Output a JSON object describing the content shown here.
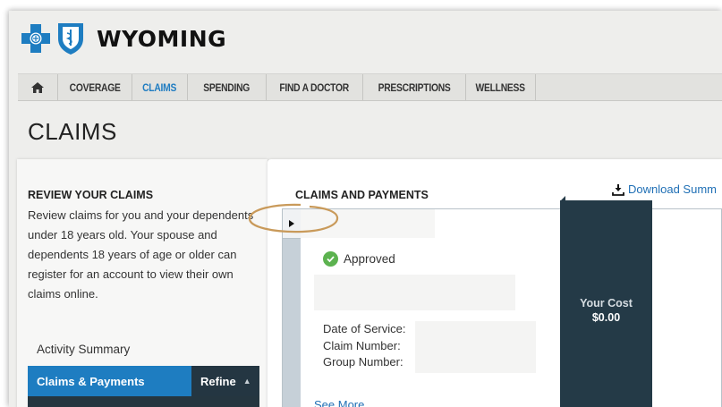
{
  "brand": {
    "name": "WYOMING",
    "cross_color": "#1e7dc1",
    "shield_color": "#1e7dc1"
  },
  "nav": {
    "home_icon": "home-icon",
    "items": [
      {
        "label": "COVERAGE",
        "active": false
      },
      {
        "label": "CLAIMS",
        "active": true
      },
      {
        "label": "SPENDING",
        "active": false
      },
      {
        "label": "FIND A DOCTOR",
        "active": false
      },
      {
        "label": "PRESCRIPTIONS",
        "active": false
      },
      {
        "label": "WELLNESS",
        "active": false
      }
    ]
  },
  "page": {
    "title": "CLAIMS"
  },
  "review": {
    "heading": "REVIEW YOUR CLAIMS",
    "text": "Review claims for you and your dependents under 18 years old. Your spouse and dependents 18 years of age or older can register for an account to view their own claims online.",
    "activity_summary": "Activity Summary",
    "bar_label": "Claims & Payments",
    "refine_label": "Refine"
  },
  "claims": {
    "heading": "CLAIMS AND PAYMENTS",
    "download_label": "Download Summ",
    "status": "Approved",
    "fields": {
      "date_of_service": "Date of Service:",
      "claim_number": "Claim Number:",
      "group_number": "Group Number:"
    },
    "see_more": "See More",
    "your_cost_label": "Your Cost",
    "your_cost_value": "$0.00"
  },
  "colors": {
    "accent": "#1e7dc1",
    "dark": "#243a47",
    "approved": "#5cb24f",
    "annotation": "#c99a5a"
  }
}
